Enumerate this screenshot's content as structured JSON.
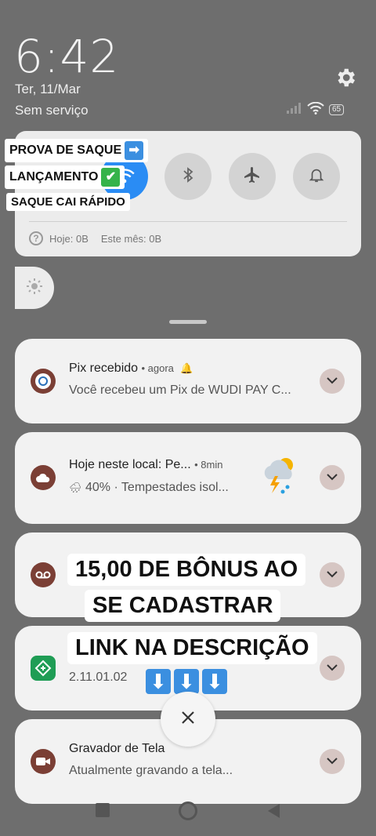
{
  "status": {
    "time": "6:42",
    "date": "Ter, 11/Mar",
    "service": "Sem serviço",
    "battery": "65"
  },
  "quick_settings": {
    "data_today": "Hoje: 0B",
    "data_month": "Este mês: 0B"
  },
  "overlay": {
    "tag1": "PROVA DE SAQUE",
    "tag2": "LANÇAMENTO",
    "tag3": "SAQUE CAI RÁPIDO",
    "banner1": "15,00 DE BÔNUS AO",
    "banner2": "SE CADASTRAR",
    "banner3": "LINK NA DESCRIÇÃO"
  },
  "notifications": [
    {
      "title": "Pix recebido",
      "time": "• agora",
      "body": "Você recebeu um Pix de WUDI PAY C..."
    },
    {
      "title": "Hoje neste local: Pe...",
      "time": "• 8min",
      "body": "40% · Tempestades isol..."
    },
    {
      "title": "",
      "time": "",
      "body": ""
    },
    {
      "title": "",
      "time": "",
      "body": "2.11.01.02"
    },
    {
      "title": "Gravador de Tela",
      "time": "",
      "body": "Atualmente gravando a tela..."
    }
  ],
  "colors": {
    "accent": "#2a8cf4",
    "card": "#f2f2f2",
    "scrim": "#6e6e6e"
  }
}
